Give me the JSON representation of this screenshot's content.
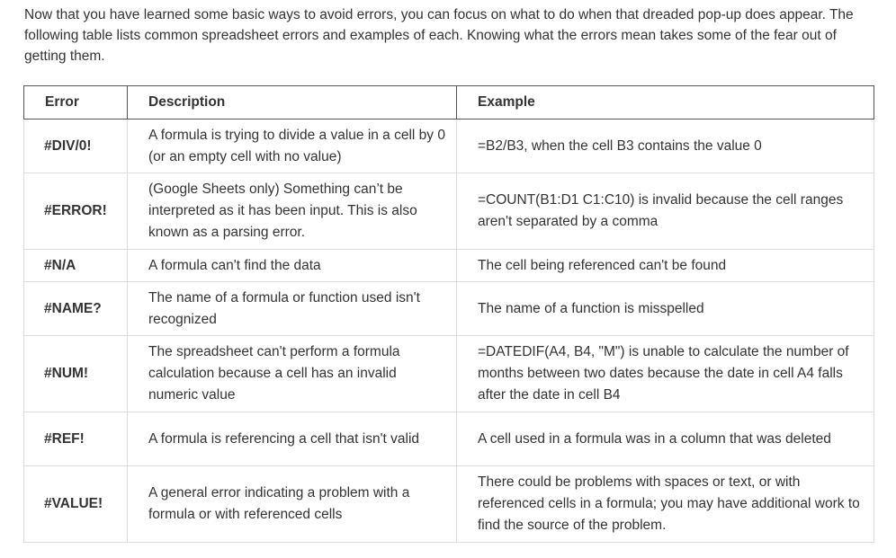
{
  "intro": "Now that you have learned some basic ways to avoid errors, you can focus on what to do when that dreaded pop-up does appear. The following table lists common spreadsheet errors and examples of each. Knowing what the errors mean takes some of the fear out of getting them.",
  "table": {
    "headers": [
      "Error",
      "Description",
      "Example"
    ],
    "rows": [
      {
        "error": "#DIV/0!",
        "description": "A formula is trying to divide a value in a cell by 0 (or an empty cell with no value)",
        "example": "=B2/B3, when the cell B3 contains the value 0"
      },
      {
        "error": "#ERROR!",
        "description": "(Google Sheets only)  Something can’t be interpreted as it has been input. This is also known as a parsing error.",
        "example": "=COUNT(B1:D1 C1:C10) is invalid because the cell ranges aren't separated by a comma"
      },
      {
        "error": "#N/A",
        "description": "A formula can't find the data",
        "example": "The cell being referenced can't be found"
      },
      {
        "error": "#NAME?",
        "description": "The name of a formula or function used isn't recognized",
        "example": "The name of a function is misspelled"
      },
      {
        "error": "#NUM!",
        "description": "The spreadsheet can't perform a formula calculation because a cell has an invalid numeric value",
        "example": "=DATEDIF(A4, B4, \"M\")  is unable to calculate the number of months between two dates because the date in cell A4 falls after the date in cell B4"
      },
      {
        "error": "#REF!",
        "description": "A formula is referencing a cell that isn't valid",
        "example": "A cell used in a formula was in a column that was deleted"
      },
      {
        "error": "#VALUE!",
        "description": "A general error indicating a problem with a formula or with referenced cells",
        "example": "There could be problems with spaces or text, or with referenced cells in a formula; you may have additional work to find the source of the problem."
      }
    ]
  }
}
